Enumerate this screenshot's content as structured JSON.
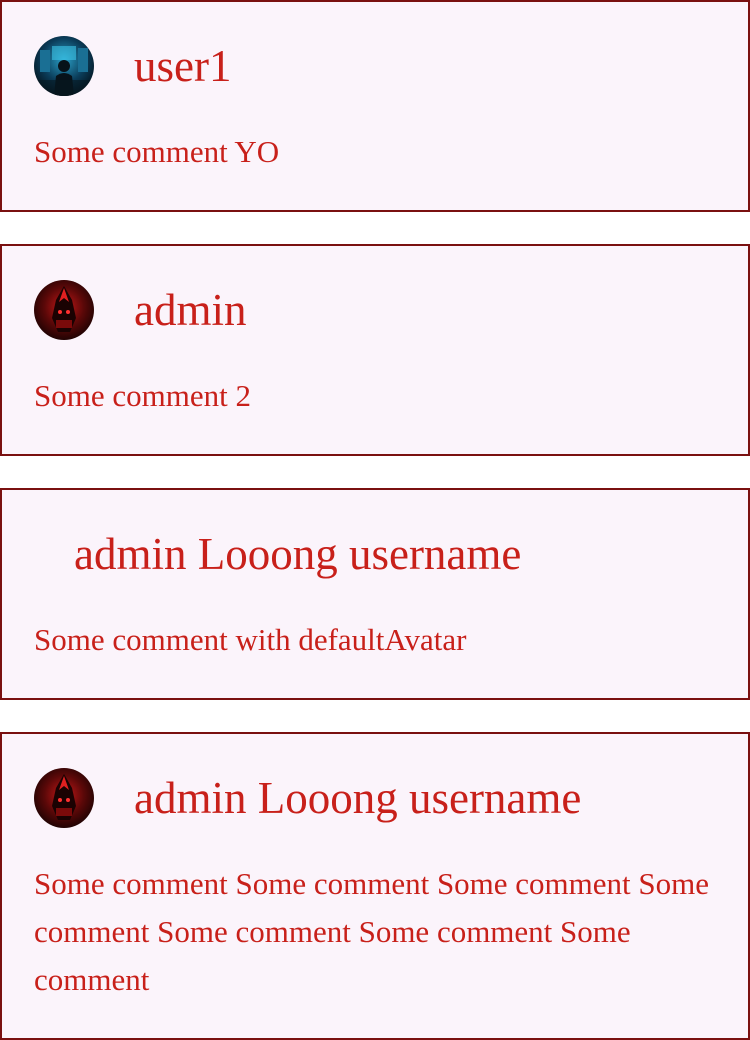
{
  "comments": [
    {
      "username": "user1",
      "avatar": "city-hacker-avatar",
      "text": "Some comment YO"
    },
    {
      "username": "admin",
      "avatar": "red-hooded-avatar",
      "text": "Some comment 2"
    },
    {
      "username": "admin Looong username",
      "avatar": "default-avatar",
      "text": "Some comment with defaultAvatar"
    },
    {
      "username": "admin Looong username",
      "avatar": "red-hooded-avatar",
      "text": "Some comment Some comment Some comment Some comment Some comment Some comment Some comment"
    }
  ],
  "colors": {
    "text": "#c8201a",
    "border": "#7a1010",
    "card_background": "#fbf4fb"
  }
}
